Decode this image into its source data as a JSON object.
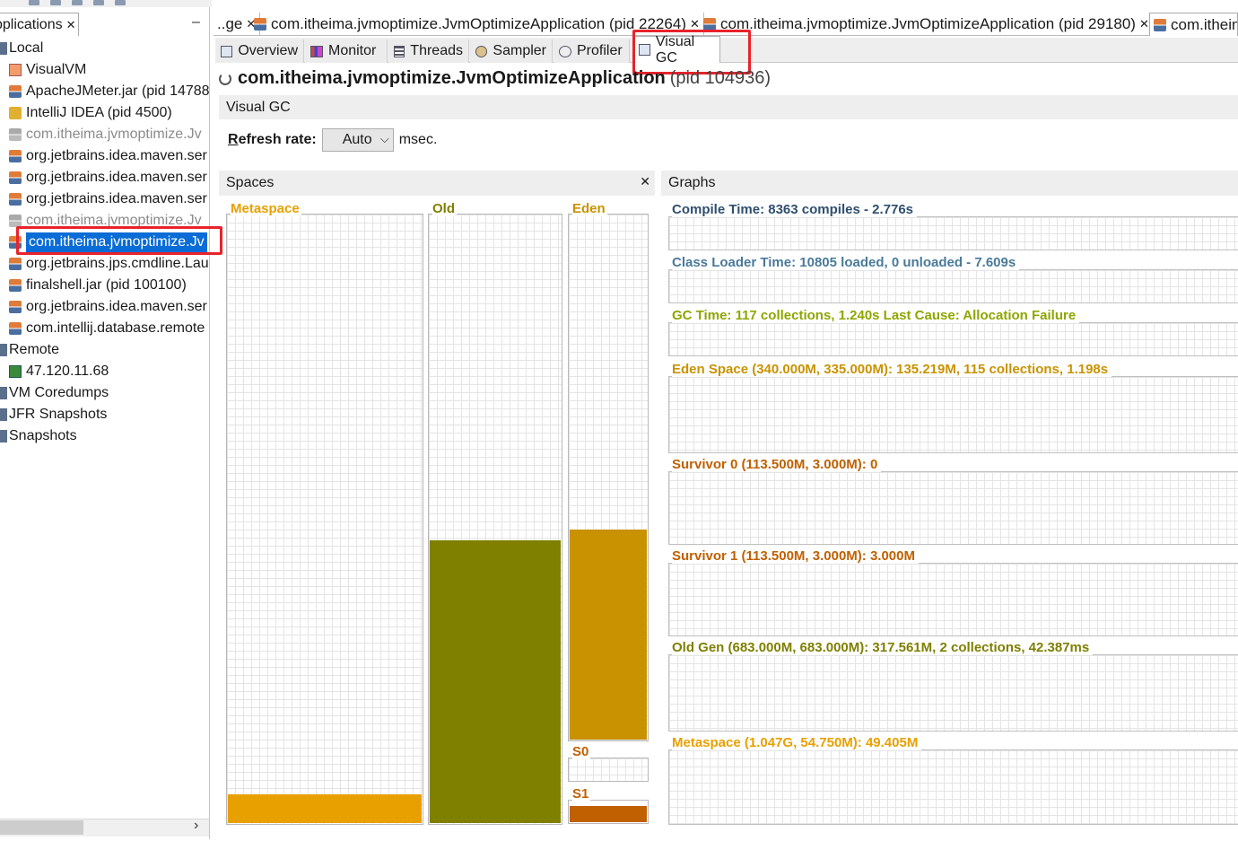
{
  "left_panel": {
    "tab_label": "pplications",
    "tree": [
      {
        "label": "Local",
        "icon": "folder-icon",
        "state": "normal"
      },
      {
        "label": "VisualVM",
        "icon": "visualvm-icon",
        "state": "normal"
      },
      {
        "label": "ApacheJMeter.jar (pid 14788",
        "icon": "java-icon",
        "state": "normal"
      },
      {
        "label": "IntelliJ IDEA (pid 4500)",
        "icon": "intellij-icon",
        "state": "normal"
      },
      {
        "label": "com.itheima.jvmoptimize.Jv",
        "icon": "java-icon",
        "state": "gray"
      },
      {
        "label": "org.jetbrains.idea.maven.ser",
        "icon": "java-icon",
        "state": "normal"
      },
      {
        "label": "org.jetbrains.idea.maven.ser",
        "icon": "java-icon",
        "state": "normal"
      },
      {
        "label": "org.jetbrains.idea.maven.ser",
        "icon": "java-icon",
        "state": "normal"
      },
      {
        "label": "com.itheima.jvmoptimize.Jv",
        "icon": "java-icon",
        "state": "gray"
      },
      {
        "label": "com.itheima.jvmoptimize.Jv",
        "icon": "java-icon",
        "state": "selected"
      },
      {
        "label": "org.jetbrains.jps.cmdline.Lau",
        "icon": "java-icon",
        "state": "normal"
      },
      {
        "label": "finalshell.jar (pid 100100)",
        "icon": "java-icon",
        "state": "normal"
      },
      {
        "label": "org.jetbrains.idea.maven.ser",
        "icon": "java-icon",
        "state": "normal"
      },
      {
        "label": "com.intellij.database.remote",
        "icon": "java-icon",
        "state": "normal"
      },
      {
        "label": "Remote",
        "icon": "folder-icon",
        "state": "normal"
      },
      {
        "label": "47.120.11.68",
        "icon": "host-icon",
        "state": "normal"
      },
      {
        "label": "VM Coredumps",
        "icon": "folder-icon",
        "state": "normal"
      },
      {
        "label": "JFR Snapshots",
        "icon": "folder-icon",
        "state": "normal"
      },
      {
        "label": "Snapshots",
        "icon": "folder-icon",
        "state": "normal"
      }
    ]
  },
  "doc_tabs": [
    {
      "label": "..ge",
      "closable": true
    },
    {
      "label": "com.itheima.jvmoptimize.JvmOptimizeApplication (pid 22264)",
      "closable": true
    },
    {
      "label": "com.itheima.jvmoptimize.JvmOptimizeApplication (pid 29180)",
      "closable": true
    },
    {
      "label": "com.itheim",
      "closable": false
    }
  ],
  "sub_tabs": [
    {
      "label": "Overview",
      "icon": "overview-icon"
    },
    {
      "label": "Monitor",
      "icon": "monitor-icon"
    },
    {
      "label": "Threads",
      "icon": "threads-icon"
    },
    {
      "label": "Sampler",
      "icon": "sampler-icon"
    },
    {
      "label": "Profiler",
      "icon": "profiler-icon"
    },
    {
      "label": "Visual GC",
      "icon": "visual-gc-icon",
      "active": true
    }
  ],
  "app_title": {
    "name": "com.itheima.jvmoptimize.JvmOptimizeApplication",
    "pid": "(pid 104936)"
  },
  "visual_gc": {
    "header": "Visual GC",
    "refresh_label_first": "R",
    "refresh_label_rest": "efresh rate:",
    "refresh_value": "Auto",
    "refresh_unit": "msec."
  },
  "spaces": {
    "title": "Spaces",
    "boxes": {
      "metaspace": {
        "label": "Metaspace",
        "fill_fraction": 0.047,
        "color": "#e8a000"
      },
      "old": {
        "label": "Old",
        "fill_fraction": 0.465,
        "color": "#7f7f00"
      },
      "eden": {
        "label": "Eden",
        "fill_fraction": 0.4,
        "color": "#c99200"
      },
      "s0": {
        "label": "S0",
        "fill_fraction": 0.0,
        "color": "#c06000"
      },
      "s1": {
        "label": "S1",
        "fill_fraction": 1.0,
        "color": "#c06000"
      }
    }
  },
  "graphs": {
    "title": "Graphs",
    "rows": [
      {
        "label": "Compile Time: 8363 compiles - 2.776s",
        "color": "#2f4f6f"
      },
      {
        "label": "Class Loader Time: 10805 loaded, 0 unloaded - 7.609s",
        "color": "#4a7a9a"
      },
      {
        "label": "GC Time: 117 collections, 1.240s  Last Cause: Allocation Failure",
        "color": "#8fa600"
      },
      {
        "label": "Eden Space (340.000M, 335.000M): 135.219M, 115 collections, 1.198s",
        "color": "#c99200"
      },
      {
        "label": "Survivor 0 (113.500M, 3.000M): 0",
        "color": "#c06000"
      },
      {
        "label": "Survivor 1 (113.500M, 3.000M): 3.000M",
        "color": "#c06000"
      },
      {
        "label": "Old Gen (683.000M, 683.000M): 317.561M, 2 collections, 42.387ms",
        "color": "#7f7f00"
      },
      {
        "label": "Metaspace (1.047G, 54.750M): 49.405M",
        "color": "#e8a000"
      }
    ]
  }
}
